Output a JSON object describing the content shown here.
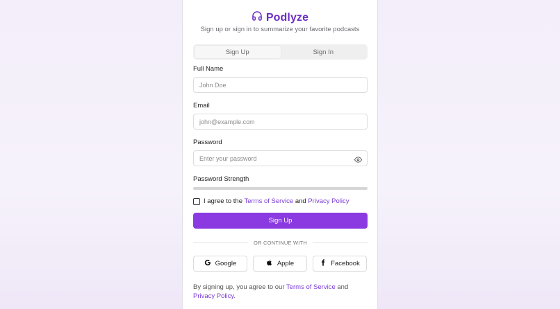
{
  "brand": {
    "name": "Podlyze",
    "icon": "headphones-icon",
    "color": "#6b2fc4"
  },
  "subtitle": "Sign up or sign in to summarize your favorite podcasts",
  "tabs": [
    {
      "label": "Sign Up",
      "active": true
    },
    {
      "label": "Sign In",
      "active": false
    }
  ],
  "form": {
    "full_name": {
      "label": "Full Name",
      "placeholder": "John Doe",
      "value": ""
    },
    "email": {
      "label": "Email",
      "placeholder": "john@example.com",
      "value": ""
    },
    "password": {
      "label": "Password",
      "placeholder": "Enter your password",
      "value": ""
    },
    "strength": {
      "label": "Password Strength",
      "level": 0
    },
    "agree": {
      "checked": false,
      "prefix": "I agree to the",
      "terms": "Terms of Service",
      "and": "and",
      "privacy": "Privacy Policy"
    },
    "submit_label": "Sign Up"
  },
  "divider_text": "OR CONTINUE WITH",
  "social": [
    {
      "label": "Google",
      "icon": "google-icon"
    },
    {
      "label": "Apple",
      "icon": "apple-icon"
    },
    {
      "label": "Facebook",
      "icon": "facebook-icon"
    }
  ],
  "footer": {
    "prefix": "By signing up, you agree to our",
    "terms": "Terms of Service",
    "and": "and",
    "privacy": "Privacy Policy",
    "suffix": "."
  },
  "colors": {
    "accent": "#8a3ae0",
    "link": "#7a3dd6"
  }
}
